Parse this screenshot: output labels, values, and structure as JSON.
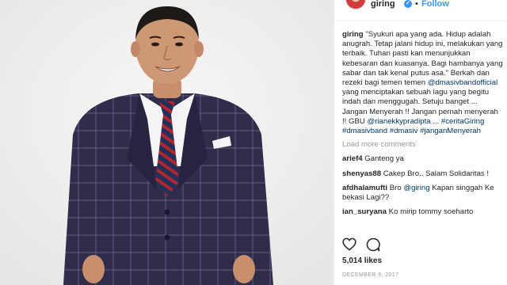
{
  "header": {
    "username": "giring",
    "verified_mark": "✓",
    "separator": "•",
    "follow_label": "Follow"
  },
  "caption": {
    "username": "giring",
    "text_1": "\"Syukuri apa yang ada. Hidup adalah anugrah. Tetap jalani hidup ini, melakukan yang terbaik. Tuhan pasti kan menunjukkan kebesaran dan kuasanya. Bagi hambanya yang sabar dan tak kenal putus asa.\" Berkah dan rezeki bagi temen temen ",
    "mention_1": "@dmasivbandofficial",
    "text_2": " yang menciptakan sebuah lagu yang begitu indah dan menggugah. Setuju banget ... Jangan Menyerah !! Jangan pernah menyerah !! GBU ",
    "mention_2": "@rianekkypradipta",
    "text_3": " ... ",
    "hashtag_1": "#ceritaGiring",
    "hashtag_2": "#dmasivband",
    "hashtag_3": "#dmasiv",
    "hashtag_4": "#janganMenyerah"
  },
  "load_more_label": "Load more comments",
  "comments": [
    {
      "user": "arief4",
      "text": "Ganteng ya"
    },
    {
      "user": "shenyas88",
      "text": "Cakep Bro.. Salam Solidaritas !"
    },
    {
      "user": "afdhalamufti",
      "text_before": "Bro ",
      "mention": "@giring",
      "text_after": " Kapan singgah Ke bekasi Lagi??"
    },
    {
      "user": "ian_suryana",
      "text": "Ko mirip tommy soeharto"
    }
  ],
  "likes": "5,014 likes",
  "date": "DECEMBER 9, 2017",
  "colors": {
    "link": "#3897f0",
    "tag": "#003569",
    "muted": "#999999",
    "text": "#262626",
    "suit": "#2f2d4a",
    "tie_red": "#b3262f",
    "tie_navy": "#23305a"
  },
  "icons": {
    "like": "heart-icon",
    "comment": "comment-icon",
    "verified": "verified-badge-icon"
  }
}
